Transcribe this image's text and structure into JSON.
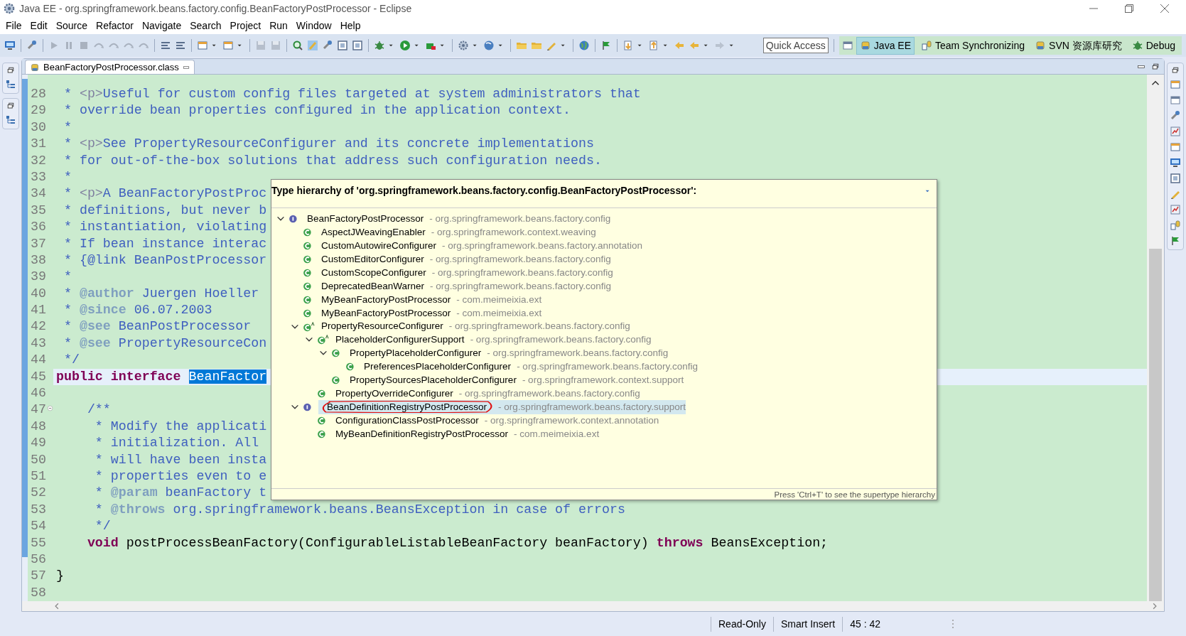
{
  "window": {
    "title": "Java EE - org.springframework.beans.factory.config.BeanFactoryPostProcessor - Eclipse"
  },
  "menu": [
    {
      "label": "File"
    },
    {
      "label": "Edit"
    },
    {
      "label": "Source"
    },
    {
      "label": "Refactor"
    },
    {
      "label": "Navigate"
    },
    {
      "label": "Search"
    },
    {
      "label": "Project"
    },
    {
      "label": "Run"
    },
    {
      "label": "Window"
    },
    {
      "label": "Help"
    }
  ],
  "quick_access": {
    "placeholder": "Quick Access"
  },
  "perspectives": [
    {
      "label": "Java EE",
      "selected": true
    },
    {
      "label": "Team Synchronizing",
      "selected": false
    },
    {
      "label": "SVN 资源库研究",
      "selected": false
    },
    {
      "label": "Debug",
      "selected": false
    }
  ],
  "editor_tab": {
    "label": "BeanFactoryPostProcessor.class"
  },
  "code_lines": [
    {
      "number": "28",
      "current": false,
      "tokens": [
        {
          "kind": "comment",
          "text": " * "
        },
        {
          "kind": "html",
          "text": "<p>"
        },
        {
          "kind": "comment",
          "text": "Useful for custom config files targeted at system administrators that"
        }
      ]
    },
    {
      "number": "29",
      "current": false,
      "tokens": [
        {
          "kind": "comment",
          "text": " * override bean properties configured in the application context."
        }
      ]
    },
    {
      "number": "30",
      "current": false,
      "tokens": [
        {
          "kind": "comment",
          "text": " *"
        }
      ]
    },
    {
      "number": "31",
      "current": false,
      "tokens": [
        {
          "kind": "comment",
          "text": " * "
        },
        {
          "kind": "html",
          "text": "<p>"
        },
        {
          "kind": "comment",
          "text": "See PropertyResourceConfigurer and its concrete implementations"
        }
      ]
    },
    {
      "number": "32",
      "current": false,
      "tokens": [
        {
          "kind": "comment",
          "text": " * for out-of-the-box solutions that address such configuration needs."
        }
      ]
    },
    {
      "number": "33",
      "current": false,
      "tokens": [
        {
          "kind": "comment",
          "text": " *"
        }
      ]
    },
    {
      "number": "34",
      "current": false,
      "tokens": [
        {
          "kind": "comment",
          "text": " * "
        },
        {
          "kind": "html",
          "text": "<p>"
        },
        {
          "kind": "comment",
          "text": "A BeanFactoryPostProc"
        }
      ]
    },
    {
      "number": "35",
      "current": false,
      "tokens": [
        {
          "kind": "comment",
          "text": " * definitions, but never b"
        }
      ]
    },
    {
      "number": "36",
      "current": false,
      "tokens": [
        {
          "kind": "comment",
          "text": " * instantiation, violating"
        }
      ]
    },
    {
      "number": "37",
      "current": false,
      "tokens": [
        {
          "kind": "comment",
          "text": " * If bean instance interac"
        }
      ]
    },
    {
      "number": "38",
      "current": false,
      "tokens": [
        {
          "kind": "comment",
          "text": " * {@link BeanPostProcessor"
        }
      ]
    },
    {
      "number": "39",
      "current": false,
      "tokens": [
        {
          "kind": "comment",
          "text": " *"
        }
      ]
    },
    {
      "number": "40",
      "current": false,
      "tokens": [
        {
          "kind": "comment",
          "text": " * "
        },
        {
          "kind": "tag",
          "text": "@author"
        },
        {
          "kind": "comment",
          "text": " Juergen Hoeller"
        }
      ]
    },
    {
      "number": "41",
      "current": false,
      "tokens": [
        {
          "kind": "comment",
          "text": " * "
        },
        {
          "kind": "tag",
          "text": "@since"
        },
        {
          "kind": "comment",
          "text": " 06.07.2003"
        }
      ]
    },
    {
      "number": "42",
      "current": false,
      "tokens": [
        {
          "kind": "comment",
          "text": " * "
        },
        {
          "kind": "tag",
          "text": "@see"
        },
        {
          "kind": "comment",
          "text": " BeanPostProcessor"
        }
      ]
    },
    {
      "number": "43",
      "current": false,
      "tokens": [
        {
          "kind": "comment",
          "text": " * "
        },
        {
          "kind": "tag",
          "text": "@see"
        },
        {
          "kind": "comment",
          "text": " PropertyResourceCon"
        }
      ]
    },
    {
      "number": "44",
      "current": false,
      "tokens": [
        {
          "kind": "comment",
          "text": " */"
        }
      ]
    },
    {
      "number": "45",
      "current": true,
      "tokens": [
        {
          "kind": "keyword",
          "text": "public interface "
        },
        {
          "kind": "selection",
          "text": "BeanFactor"
        }
      ]
    },
    {
      "number": "46",
      "current": false
    },
    {
      "number": "47",
      "current": false,
      "collapse_marker": true,
      "tokens": [
        {
          "kind": "comment",
          "text": "    /**"
        }
      ]
    },
    {
      "number": "48",
      "current": false,
      "tokens": [
        {
          "kind": "comment",
          "text": "     * Modify the applicati"
        }
      ]
    },
    {
      "number": "49",
      "current": false,
      "tokens": [
        {
          "kind": "comment",
          "text": "     * initialization. All"
        }
      ]
    },
    {
      "number": "50",
      "current": false,
      "tokens": [
        {
          "kind": "comment",
          "text": "     * will have been insta"
        }
      ]
    },
    {
      "number": "51",
      "current": false,
      "tokens": [
        {
          "kind": "comment",
          "text": "     * properties even to e"
        }
      ]
    },
    {
      "number": "52",
      "current": false,
      "tokens": [
        {
          "kind": "comment",
          "text": "     * "
        },
        {
          "kind": "tag",
          "text": "@param"
        },
        {
          "kind": "comment",
          "text": " beanFactory t"
        }
      ]
    },
    {
      "number": "53",
      "current": false,
      "tokens": [
        {
          "kind": "comment",
          "text": "     * "
        },
        {
          "kind": "tag",
          "text": "@throws"
        },
        {
          "kind": "comment",
          "text": " org.springframework.beans.BeansException in case of errors"
        }
      ]
    },
    {
      "number": "54",
      "current": false,
      "tokens": [
        {
          "kind": "comment",
          "text": "     */"
        }
      ]
    },
    {
      "number": "55",
      "current": false,
      "tokens": [
        {
          "kind": "keyword",
          "text": "    void"
        },
        {
          "kind": "plain",
          "text": " postProcessBeanFactory(ConfigurableListableBeanFactory beanFactory) "
        },
        {
          "kind": "keyword",
          "text": "throws"
        },
        {
          "kind": "plain",
          "text": " BeansException;"
        }
      ]
    },
    {
      "number": "56",
      "current": false
    },
    {
      "number": "57",
      "current": false,
      "tokens": [
        {
          "kind": "plain",
          "text": "}"
        }
      ]
    },
    {
      "number": "58",
      "current": false
    }
  ],
  "hierarchy_popup": {
    "title": "Type hierarchy of 'org.springframework.beans.factory.config.BeanFactoryPostProcessor':",
    "hint": "Press 'Ctrl+T' to see the supertype hierarchy",
    "tree": [
      {
        "name": "BeanFactoryPostProcessor",
        "detail": "- org.springframework.beans.factory.config",
        "kind": "interface",
        "expanded": true,
        "selected": false,
        "children": [
          {
            "name": "AspectJWeavingEnabler",
            "detail": "- org.springframework.context.weaving",
            "kind": "class",
            "selected": false
          },
          {
            "name": "CustomAutowireConfigurer",
            "detail": "- org.springframework.beans.factory.annotation",
            "kind": "class",
            "selected": false
          },
          {
            "name": "CustomEditorConfigurer",
            "detail": "- org.springframework.beans.factory.config",
            "kind": "class",
            "selected": false
          },
          {
            "name": "CustomScopeConfigurer",
            "detail": "- org.springframework.beans.factory.config",
            "kind": "class",
            "selected": false
          },
          {
            "name": "DeprecatedBeanWarner",
            "detail": "- org.springframework.beans.factory.config",
            "kind": "class",
            "selected": false
          },
          {
            "name": "MyBeanFactoryPostProcessor",
            "detail": "- com.meimeixia.ext",
            "kind": "class",
            "selected": false
          },
          {
            "name": "MyBeanFactoryPostProcessor",
            "detail": "- com.meimeixia.ext",
            "kind": "class",
            "selected": false
          },
          {
            "name": "PropertyResourceConfigurer",
            "detail": "- org.springframework.beans.factory.config",
            "kind": "abstract",
            "expanded": true,
            "selected": false,
            "children": [
              {
                "name": "PlaceholderConfigurerSupport",
                "detail": "- org.springframework.beans.factory.config",
                "kind": "abstract",
                "expanded": true,
                "selected": false,
                "children": [
                  {
                    "name": "PropertyPlaceholderConfigurer",
                    "detail": "- org.springframework.beans.factory.config",
                    "kind": "class",
                    "expanded": true,
                    "selected": false,
                    "children": [
                      {
                        "name": "PreferencesPlaceholderConfigurer",
                        "detail": "- org.springframework.beans.factory.config",
                        "kind": "class",
                        "selected": false
                      }
                    ]
                  },
                  {
                    "name": "PropertySourcesPlaceholderConfigurer",
                    "detail": "- org.springframework.context.support",
                    "kind": "class",
                    "selected": false
                  }
                ]
              },
              {
                "name": "PropertyOverrideConfigurer",
                "detail": "- org.springframework.beans.factory.config",
                "kind": "class",
                "selected": false
              }
            ]
          },
          {
            "name": "BeanDefinitionRegistryPostProcessor",
            "detail": "- org.springframework.beans.factory.support",
            "kind": "interface",
            "expanded": true,
            "selected": true,
            "circled": true,
            "children": [
              {
                "name": "ConfigurationClassPostProcessor",
                "detail": "- org.springframework.context.annotation",
                "kind": "class",
                "selected": false
              },
              {
                "name": "MyBeanDefinitionRegistryPostProcessor",
                "detail": "- com.meimeixia.ext",
                "kind": "class",
                "selected": false
              }
            ]
          }
        ]
      }
    ]
  },
  "status_bar": [
    {
      "text": "Read-Only"
    },
    {
      "text": "Smart Insert"
    },
    {
      "text": "45 : 42"
    }
  ]
}
